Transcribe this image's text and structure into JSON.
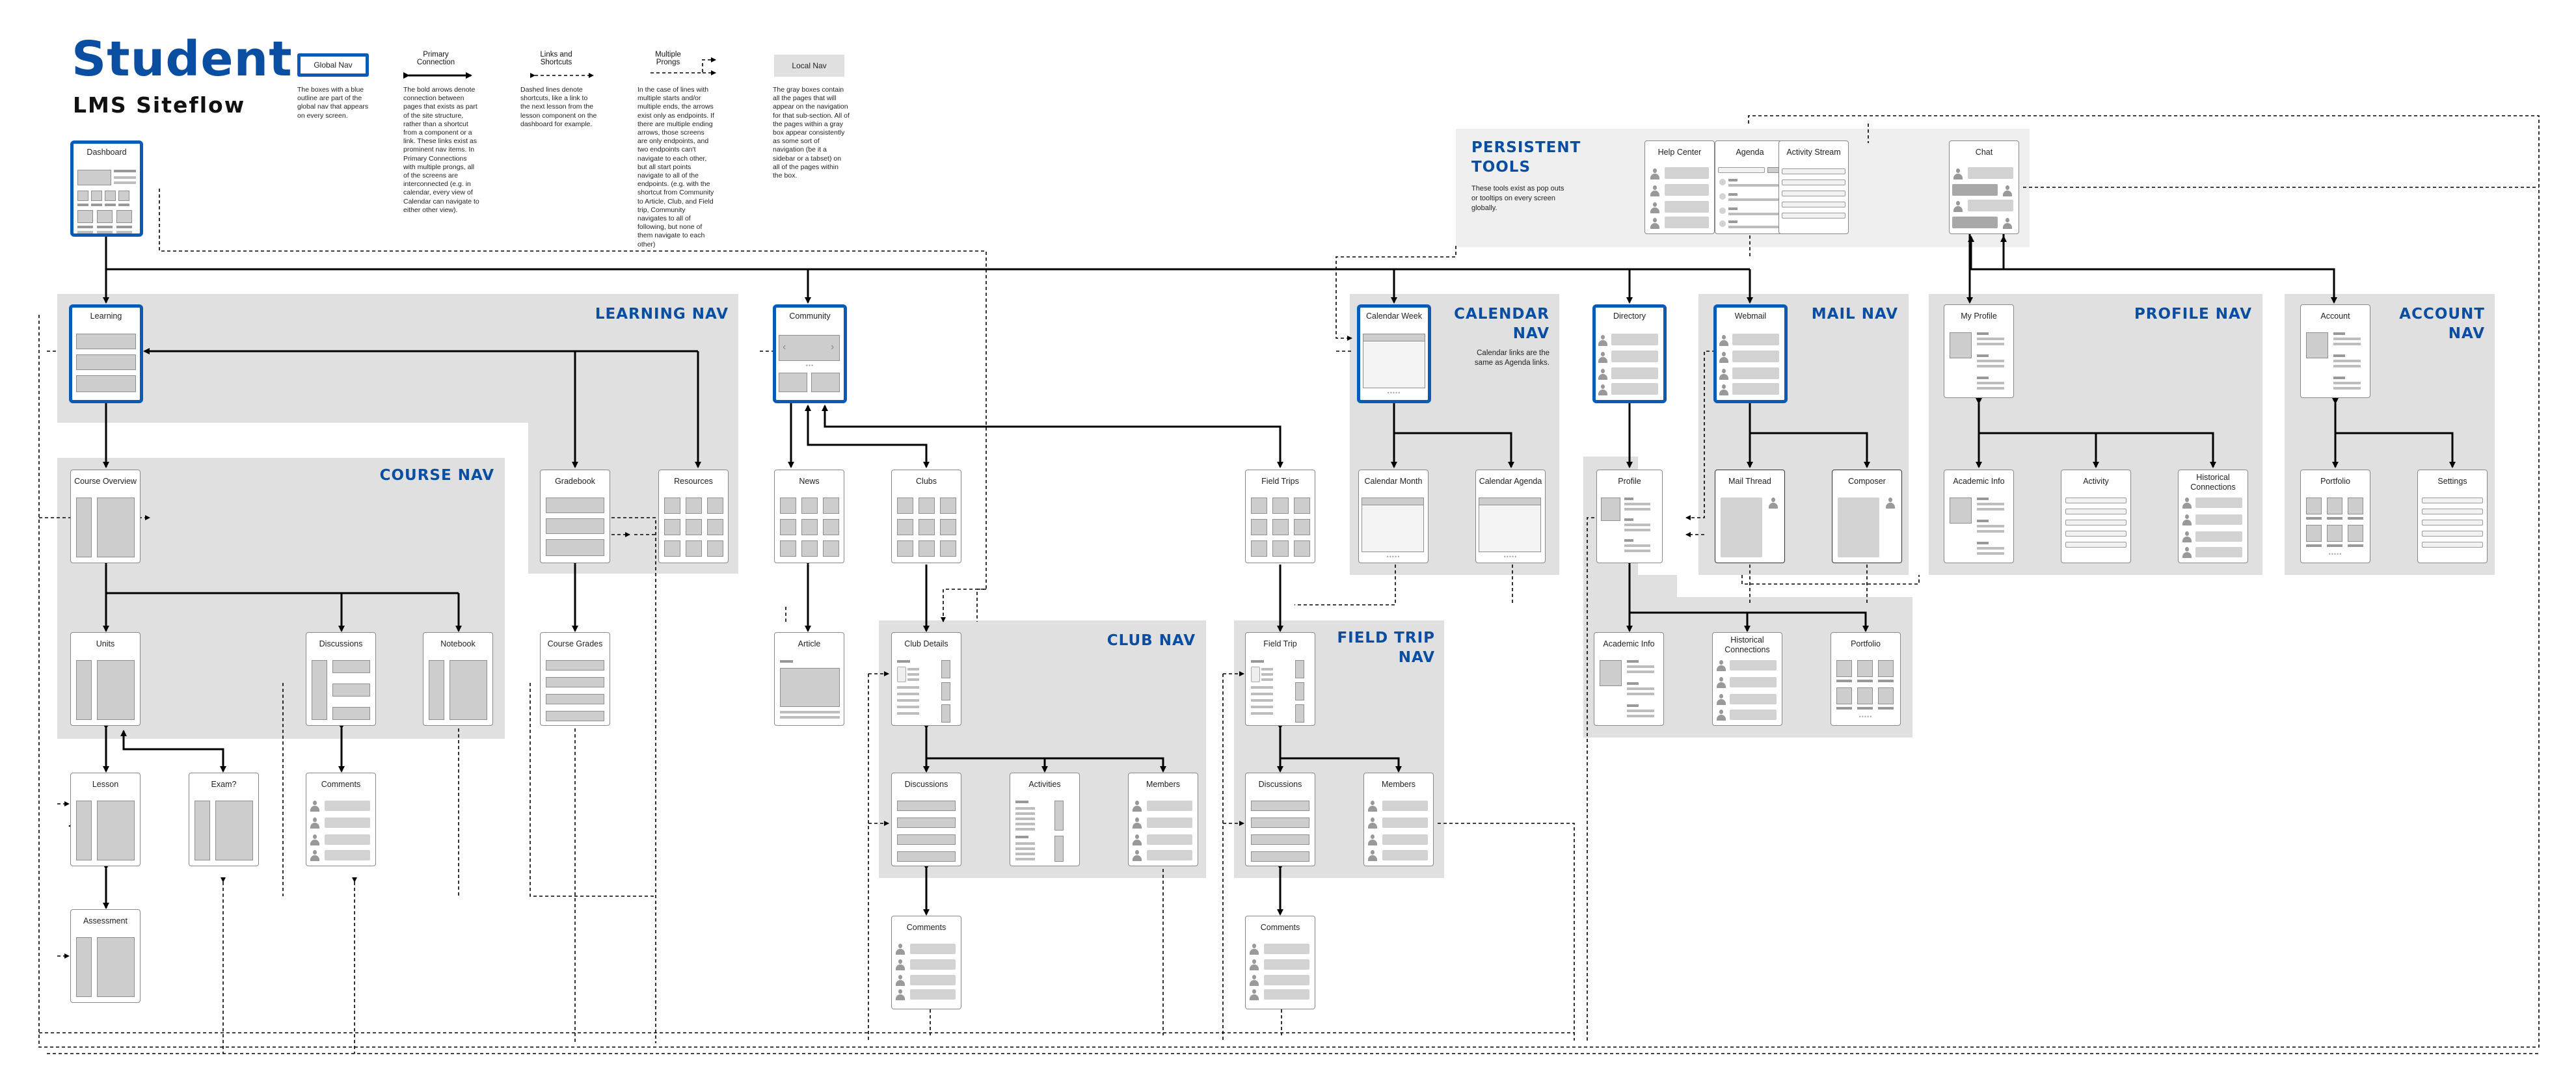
{
  "header": {
    "title": "Student",
    "subtitle": "LMS Siteflow"
  },
  "legend": {
    "global_nav": {
      "label": "Global Nav",
      "desc": "The boxes with a blue outline are part of the global nav that appears on every screen."
    },
    "primary": {
      "label_line1": "Primary",
      "label_line2": "Connection",
      "desc": "The bold arrows denote connection between pages that exists as part of the site structure, rather than a shortcut from a component or a link. These links exist as prominent nav items. In Primary Connections with multiple prongs, all of the screens are interconnected (e.g. in calendar, every view of Calendar can navigate to either other view)."
    },
    "links": {
      "label_line1": "Links and",
      "label_line2": "Shortcuts",
      "desc": "Dashed lines denote shortcuts, like a link to the next lesson from the lesson component on the dashboard for example."
    },
    "prongs": {
      "label_line1": "Multiple",
      "label_line2": "Prongs",
      "desc": "In the case of lines with multiple starts and/or multiple ends, the arrows exist only as endpoints. If there are multiple ending arrows, those screens are only endpoints, and two endpoints can't navigate to each other, but all start points navigate to all of the endpoints. (e.g. with the shortcut from Community to Article, Club, and Field trip, Community navigates to all of following, but none of them navigate to each other)"
    },
    "local_nav": {
      "label": "Local Nav",
      "desc": "The gray boxes contain all the pages that will appear on the navigation for that sub-section. All of the pages within a gray box appear consistently as some sort of navigation (be it a sidebar or a tabset) on all of the pages within the box."
    }
  },
  "regions": {
    "persistent": {
      "title_line1": "PERSISTENT",
      "title_line2": "TOOLS",
      "note": "These tools exist as pop outs or tooltips on every screen globally."
    },
    "learning": {
      "title": "LEARNING NAV"
    },
    "course": {
      "title": "COURSE NAV"
    },
    "calendar": {
      "title_line1": "CALENDAR",
      "title_line2": "NAV",
      "note": "Calendar links are the same as Agenda links."
    },
    "mail": {
      "title": "MAIL NAV"
    },
    "profile": {
      "title": "PROFILE NAV"
    },
    "account": {
      "title_line1": "ACCOUNT",
      "title_line2": "NAV"
    },
    "club": {
      "title": "CLUB NAV"
    },
    "fieldtrip": {
      "title_line1": "FIELD TRIP",
      "title_line2": "NAV"
    }
  },
  "nodes": {
    "dashboard": "Dashboard",
    "help_center": "Help Center",
    "agenda": "Agenda",
    "activity_stream": "Activity Stream",
    "chat": "Chat",
    "learning": "Learning",
    "course_overview": "Course Overview",
    "gradebook": "Gradebook",
    "resources": "Resources",
    "units": "Units",
    "discussions": "Discussions",
    "notebook": "Notebook",
    "course_grades": "Course Grades",
    "lesson": "Lesson",
    "exam": "Exam?",
    "comments": "Comments",
    "assessment": "Assessment",
    "community": "Community",
    "news": "News",
    "clubs": "Clubs",
    "field_trips": "Field Trips",
    "article": "Article",
    "club_details": "Club Details",
    "club_discussions": "Discussions",
    "club_activities": "Activities",
    "club_members": "Members",
    "club_comments": "Comments",
    "field_trip": "Field Trip",
    "ft_discussions": "Discussions",
    "ft_members": "Members",
    "ft_comments": "Comments",
    "calendar_week": "Calendar Week",
    "calendar_month": "Calendar Month",
    "calendar_agenda": "Calendar Agenda",
    "directory": "Directory",
    "profile": "Profile",
    "dir_academic_info": "Academic Info",
    "dir_historical_connections": "Historical Connections",
    "dir_portfolio": "Portfolio",
    "webmail": "Webmail",
    "mail_thread": "Mail Thread",
    "composer": "Composer",
    "my_profile": "My Profile",
    "academic_info": "Academic Info",
    "activity": "Activity",
    "historical_connections": "Historical Connections",
    "account": "Account",
    "portfolio": "Portfolio",
    "settings": "Settings"
  },
  "colors": {
    "brand_blue": "#0a4ea2",
    "global_outline": "#0a5bb5",
    "local_nav_gray": "#e0e0e0",
    "persistent_gray": "#efefef"
  }
}
